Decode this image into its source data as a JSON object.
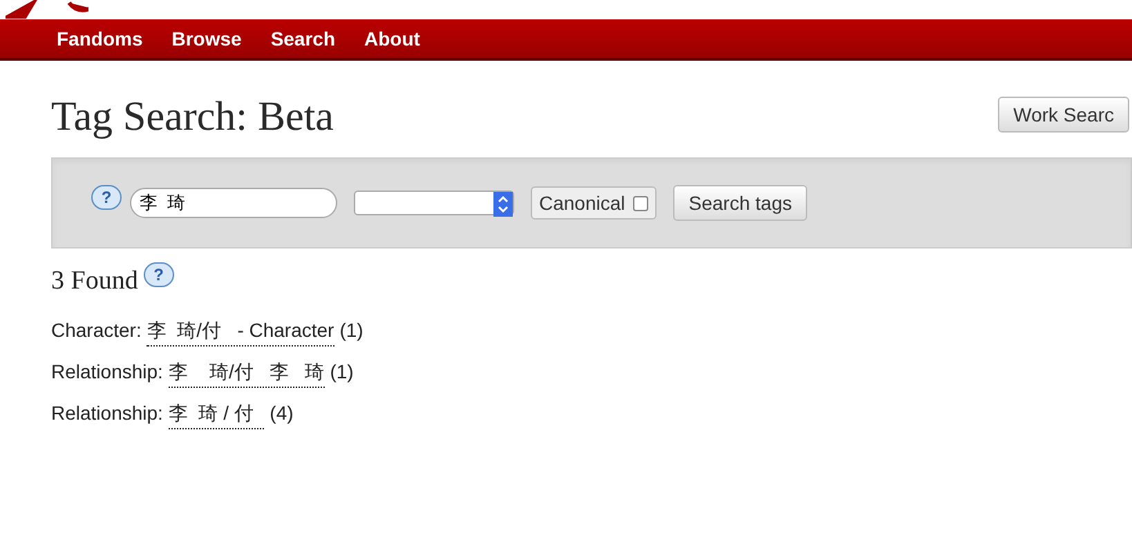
{
  "nav": [
    {
      "label": "Fandoms"
    },
    {
      "label": "Browse"
    },
    {
      "label": "Search"
    },
    {
      "label": "About"
    }
  ],
  "title": "Tag Search: Beta",
  "work_search_button": "Work Searc",
  "search_form": {
    "help": "?",
    "query": "李  琦",
    "canonical_label": "Canonical",
    "canonical_checked": false,
    "submit": "Search tags"
  },
  "results_heading": "3 Found",
  "results_help": "?",
  "results": [
    {
      "type": "Character:",
      "tag": "李  琦/付   - Character",
      "count": "(1)"
    },
    {
      "type": "Relationship:",
      "tag": "李    琦/付   李   琦",
      "count": "(1)"
    },
    {
      "type": "Relationship:",
      "tag": "李  琦 / 付  ",
      "count": "(4)"
    }
  ]
}
